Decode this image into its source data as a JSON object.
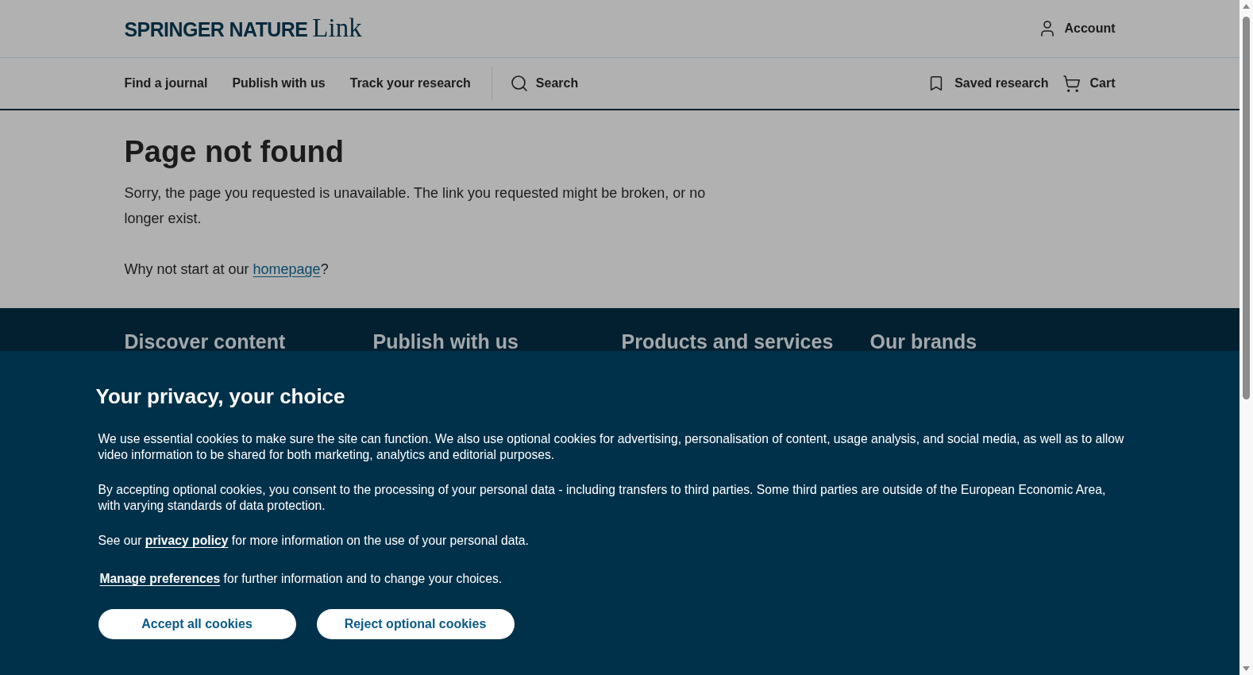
{
  "header": {
    "logo": {
      "brand": "SPRINGER NATURE",
      "product": "Link"
    },
    "account": "Account"
  },
  "nav": {
    "items": [
      "Find a journal",
      "Publish with us",
      "Track your research"
    ],
    "search": "Search",
    "saved": "Saved research",
    "cart": "Cart"
  },
  "main": {
    "title": "Page not found",
    "message": "Sorry, the page you requested is unavailable. The link you requested might be broken, or no longer exist.",
    "prompt": {
      "before": "Why not start at our ",
      "link": "homepage",
      "after": "?"
    }
  },
  "footer": {
    "headings": [
      "Discover content",
      "Publish with us",
      "Products and services",
      "Our brands"
    ]
  },
  "cookie_banner": {
    "title": "Your privacy, your choice",
    "paragraphs": [
      "We use essential cookies to make sure the site can function. We also use optional cookies for advertising, personalisation of content, usage analysis, and social media, as well as to allow video information to be shared for both marketing, analytics and editorial purposes.",
      "By accepting optional cookies, you consent to the processing of your personal data - including transfers to third parties. Some third parties are outside of the European Economic Area, with varying standards of data protection."
    ],
    "privacy": {
      "before": "See our ",
      "link": "privacy policy",
      "after": " for more information on the use of your personal data."
    },
    "manage": {
      "link": "Manage preferences",
      "after": " for further information and to change your choices."
    },
    "buttons": [
      "Accept all cookies",
      "Reject optional cookies"
    ]
  }
}
